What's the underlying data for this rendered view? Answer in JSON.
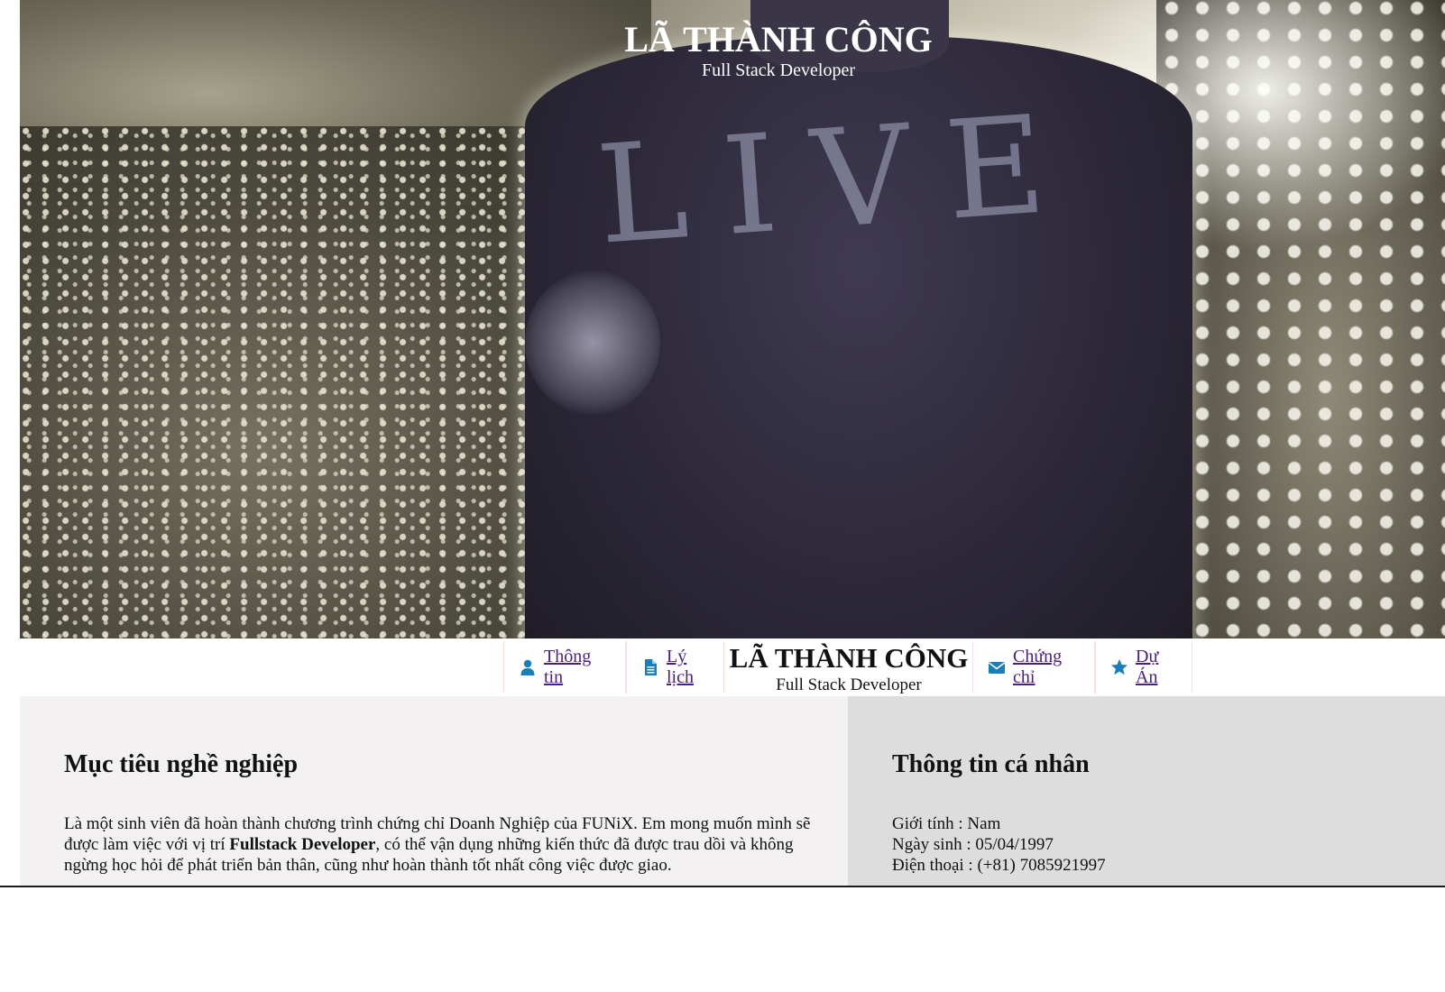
{
  "hero": {
    "name": "LÃ THÀNH CÔNG",
    "role": "Full Stack Developer",
    "shirt_print": "LIVE"
  },
  "nav": {
    "items": [
      {
        "label": "Thông tin",
        "icon": "user-icon"
      },
      {
        "label": "Lý lịch",
        "icon": "document-icon"
      },
      {
        "label": "Chứng chỉ",
        "icon": "envelope-icon"
      },
      {
        "label": "Dự Án",
        "icon": "star-icon"
      }
    ],
    "brand_name": "LÃ THÀNH CÔNG",
    "brand_role": "Full Stack Developer",
    "link_color": "#4b1f7d",
    "icon_color": "#1a7fb8"
  },
  "career": {
    "title": "Mục tiêu nghề nghiệp",
    "text_before": "Là một sinh viên đã hoàn thành chương trình chứng chỉ Doanh Nghiệp của FUNiX. Em mong muốn mình sẽ được làm việc với vị trí ",
    "text_bold": "Fullstack Developer",
    "text_after": ", có thể vận dụng những kiến thức đã được trau dồi và không ngừng học hỏi để phát triển bản thân, cũng như hoàn thành tốt nhất công việc được giao."
  },
  "personal": {
    "title": "Thông tin cá nhân",
    "rows": [
      "Giới tính : Nam",
      "Ngày sinh : 05/04/1997",
      "Điện thoại : (+81) 7085921997"
    ]
  }
}
